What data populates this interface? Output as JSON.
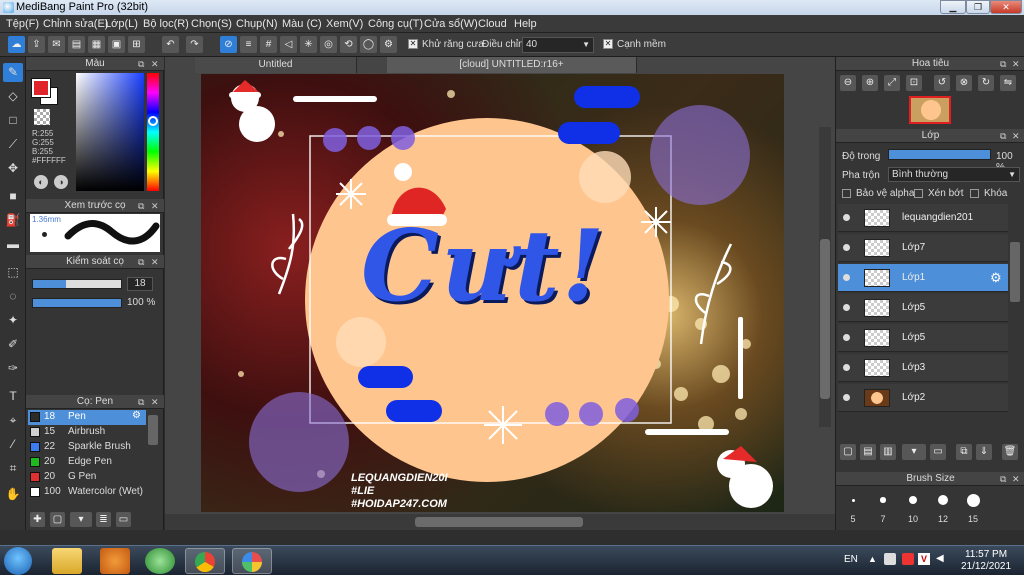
{
  "window": {
    "title": "MediBang Paint Pro (32bit)"
  },
  "menu": [
    "Tệp(F)",
    "Chỉnh sửa(E)",
    "Lớp(L)",
    "Bộ lọc(R)",
    "Chọn(S)",
    "Chụp(N)",
    "Màu (C)",
    "Xem(V)",
    "Công cụ(T)",
    "Cửa sổ(W)",
    "Cloud",
    "Help"
  ],
  "toolbar": {
    "antialias_label": "Khử răng cưa",
    "correction_label": "Điều chỉnh",
    "correction_value": "40",
    "snap_label": "Cạnh mềm"
  },
  "color_panel": {
    "title": "Màu",
    "r": "R:255",
    "g": "G:255",
    "b": "B:255",
    "hex": "#FFFFFF",
    "main_color": "#e0242c",
    "sub_color": "#ffffff"
  },
  "brush_preview": {
    "title": "Xem trước cọ",
    "size": "1.36mm"
  },
  "brush_control": {
    "title": "Kiểm soát cọ",
    "size_value": "18",
    "opacity_value": "100 %",
    "opacity_fraction": 1.0
  },
  "brush_list": {
    "title": "Cọ: Pen",
    "items": [
      {
        "num": "18",
        "name": "Pen",
        "color": "#2b2b2b",
        "selected": true
      },
      {
        "num": "15",
        "name": "Airbrush",
        "color": "#cfcfcf"
      },
      {
        "num": "22",
        "name": "Sparkle Brush",
        "color": "#3d7cf0"
      },
      {
        "num": "20",
        "name": "Edge Pen",
        "color": "#1fb91f"
      },
      {
        "num": "20",
        "name": "G Pen",
        "color": "#e03030"
      },
      {
        "num": "100",
        "name": "Watercolor (Wet)",
        "color": "#ffffff"
      }
    ]
  },
  "canvas": {
    "tabs": [
      "Untitled",
      "[cloud] UNTITLED:r16+"
    ],
    "artwork_text": "Cưt!",
    "watermark": [
      "LEQUANGDIEN20I",
      "#LIE",
      "#HOIDAP247.COM"
    ]
  },
  "navigator": {
    "title": "Hoa tiêu"
  },
  "layers": {
    "title": "Lớp",
    "opacity_label": "Độ trong",
    "opacity_value": "100 %",
    "opacity_fraction": 1.0,
    "blend_label": "Pha trộn",
    "blend_value": "Bình thường",
    "protect_alpha": "Bảo vệ alpha",
    "clipping": "Xén bớt",
    "lock": "Khóa",
    "items": [
      {
        "name": "lequangdien201"
      },
      {
        "name": "Lớp7"
      },
      {
        "name": "Lớp1",
        "selected": true
      },
      {
        "name": "Lớp5"
      },
      {
        "name": "Lớp5"
      },
      {
        "name": "Lớp3"
      },
      {
        "name": "Lớp2"
      }
    ]
  },
  "brush_size": {
    "title": "Brush Size",
    "sizes": [
      "5",
      "7",
      "10",
      "12",
      "15"
    ]
  },
  "taskbar": {
    "lang": "EN",
    "time": "11:57 PM",
    "date": "21/12/2021"
  }
}
